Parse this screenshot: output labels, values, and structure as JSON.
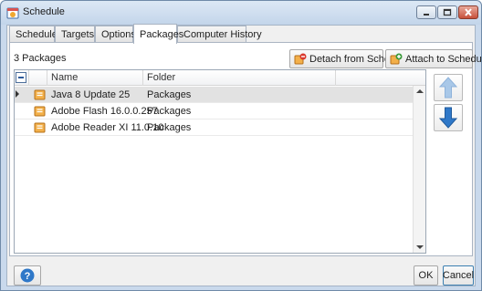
{
  "window": {
    "title": "Schedule"
  },
  "tabs": [
    {
      "label": "Schedule",
      "active": false
    },
    {
      "label": "Targets",
      "active": false
    },
    {
      "label": "Options",
      "active": false
    },
    {
      "label": "Packages",
      "active": true
    },
    {
      "label": "Computer History",
      "active": false
    }
  ],
  "packages": {
    "count_label": "3 Packages",
    "detach_label": "Detach from Schedule",
    "attach_label": "Attach to Schedule",
    "columns": [
      "Name",
      "Folder"
    ],
    "rows": [
      {
        "name": "Java 8 Update 25",
        "folder": "Packages",
        "selected": true
      },
      {
        "name": "Adobe Flash 16.0.0.257",
        "folder": "Packages",
        "selected": false
      },
      {
        "name": "Adobe Reader XI 11.0.10",
        "folder": "Packages",
        "selected": false
      }
    ]
  },
  "footer": {
    "ok_label": "OK",
    "cancel_label": "Cancel"
  },
  "icons": {
    "app": "calendar-icon",
    "package": "package-icon",
    "detach": "detach-icon",
    "attach": "attach-icon",
    "move_up": "arrow-up-icon",
    "move_down": "arrow-down-icon",
    "help": "help-icon"
  },
  "colors": {
    "accent": "#2f78c8",
    "arrow_disabled": "#a9c8e8",
    "selected_row": "#e2e2e2",
    "close_button": "#c7503a"
  }
}
